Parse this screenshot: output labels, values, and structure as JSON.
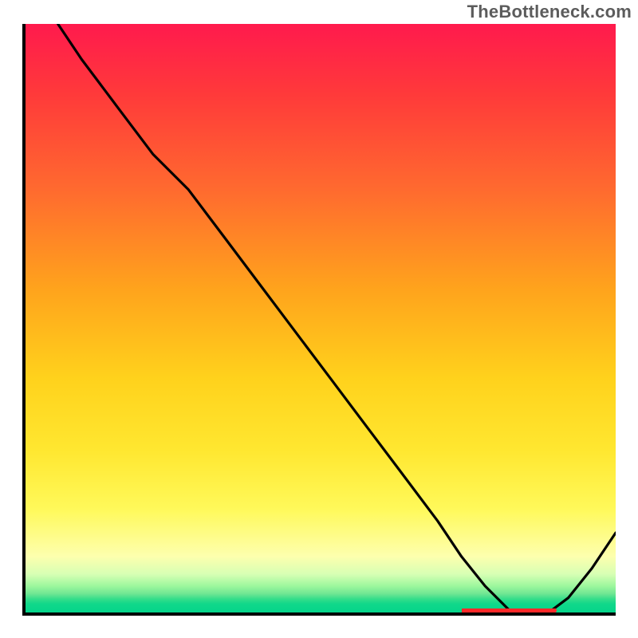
{
  "watermark": "TheBottleneck.com",
  "colors": {
    "axis": "#000000",
    "curve": "#000000",
    "sweet_spot": "#ff2a2a"
  },
  "chart_data": {
    "type": "line",
    "title": "",
    "xlabel": "",
    "ylabel": "",
    "xlim": [
      0,
      100
    ],
    "ylim": [
      0,
      100
    ],
    "x": [
      6,
      10,
      16,
      22,
      28,
      34,
      40,
      46,
      52,
      58,
      64,
      70,
      74,
      78,
      82,
      84,
      88,
      92,
      96,
      100
    ],
    "values": [
      100,
      94,
      86,
      78,
      72,
      64,
      56,
      48,
      40,
      32,
      24,
      16,
      10,
      5,
      1,
      0,
      0,
      3,
      8,
      14
    ],
    "sweet_spot_x_range": [
      74,
      90
    ],
    "background_gradient": "red-yellow-green vertical"
  }
}
